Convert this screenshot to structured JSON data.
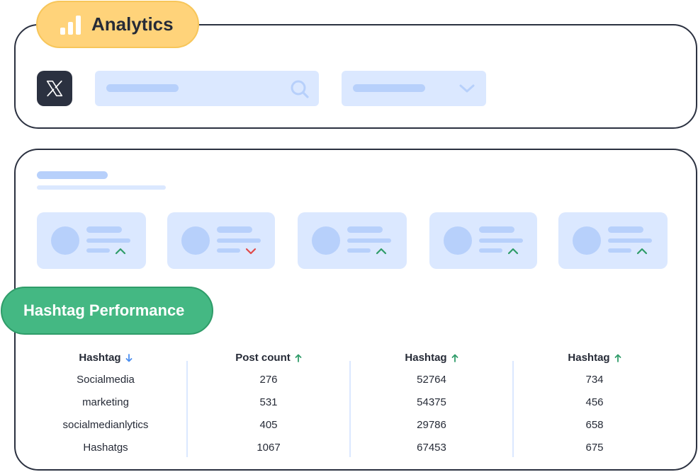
{
  "header": {
    "title": "Analytics"
  },
  "section": {
    "title": "Hashtag Performance"
  },
  "colors": {
    "accent_yellow": "#ffd37a",
    "accent_green": "#44b883",
    "skeleton_light": "#dbe8ff",
    "skeleton_mid": "#b7d0fb",
    "trend_up": "#2f9c69",
    "trend_down": "#e04a4a",
    "sort_down": "#4a8ef0"
  },
  "stat_cards": [
    {
      "trend": "up"
    },
    {
      "trend": "down"
    },
    {
      "trend": "up"
    },
    {
      "trend": "up"
    },
    {
      "trend": "up"
    }
  ],
  "table": {
    "columns": [
      {
        "label": "Hashtag",
        "sort": "desc"
      },
      {
        "label": "Post count",
        "sort": "asc"
      },
      {
        "label": "Hashtag",
        "sort": "asc"
      },
      {
        "label": "Hashtag",
        "sort": "asc"
      }
    ],
    "rows": [
      [
        "Socialmedia",
        "276",
        "52764",
        "734"
      ],
      [
        "marketing",
        "531",
        "54375",
        "456"
      ],
      [
        "socialmedianlytics",
        "405",
        "29786",
        "658"
      ],
      [
        "Hashatgs",
        "1067",
        "67453",
        "675"
      ]
    ]
  }
}
